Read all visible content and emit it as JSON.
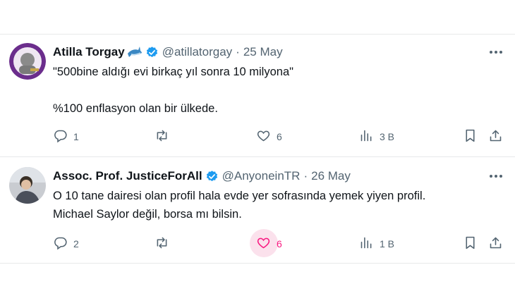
{
  "tweets": [
    {
      "name": "Atilla Torgay",
      "handle": "@atillatorgay",
      "separator": "·",
      "date": "25 May",
      "text": "\"500bine aldığı evi birkaç yıl sonra 10 milyona\"\n\n%100 enflasyon olan bir ülkede.",
      "replies": "1",
      "reposts": "",
      "likes": "6",
      "views": "3 B",
      "liked": false
    },
    {
      "name": "Assoc. Prof. JusticeForAll",
      "handle": "@AnyoneinTR",
      "separator": "·",
      "date": "26 May",
      "text": "O 10 tane dairesi olan profil hala evde yer sofrasında yemek yiyen profil.\nMichael Saylor değil, borsa mı bilsin.",
      "replies": "2",
      "reposts": "",
      "likes": "6",
      "views": "1 B",
      "liked": true
    }
  ],
  "colors": {
    "text": "#0f1419",
    "secondary": "#536471",
    "verified": "#1d9bf0",
    "like_active": "#f91880",
    "divider": "#e7e9ea"
  },
  "icons": [
    "shark-emoji-icon",
    "verified-badge-icon",
    "more-icon",
    "reply-icon",
    "repost-icon",
    "like-icon",
    "views-icon",
    "bookmark-icon",
    "share-icon"
  ]
}
